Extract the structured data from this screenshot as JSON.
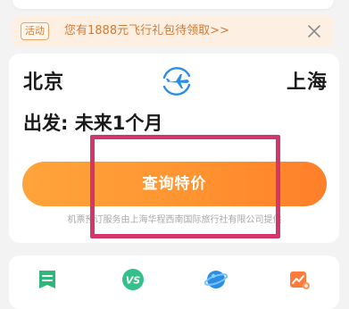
{
  "promo": {
    "tag": "活动",
    "text": "您有1888元飞行礼包待领取>>"
  },
  "route": {
    "from_city": "北京",
    "to_city": "上海"
  },
  "departure": {
    "label": "出发: 未来1个月"
  },
  "search_button": {
    "label": "查询特价"
  },
  "disclaimer": "机票预订服务由上海华程西南国际旅行社有限公司提供",
  "quick_nav": {
    "items": [
      {
        "icon": "list-icon"
      },
      {
        "icon": "vs-compare-icon"
      },
      {
        "icon": "planet-icon"
      },
      {
        "icon": "price-trend-icon"
      }
    ]
  },
  "colors": {
    "accent_orange": "#ff9430",
    "promo_text": "#d27a35",
    "highlight": "#d2366d",
    "plane_blue": "#2a8ee8"
  }
}
